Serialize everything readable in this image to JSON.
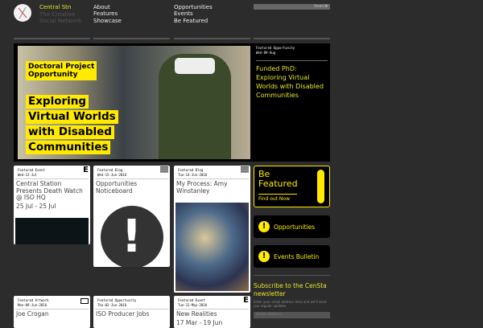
{
  "brand": {
    "name": "Central Stn",
    "tagline1": "The Creative",
    "tagline2": "Social Network"
  },
  "nav": {
    "col1": [
      "About",
      "Features",
      "Showcase"
    ],
    "col2": [
      "Opportunities",
      "Events",
      "Be Featured"
    ]
  },
  "search": {
    "placeholder": "Search"
  },
  "hero": {
    "image_line1": "Doctoral Project",
    "image_line2": "Opportunity",
    "image_title": [
      "Exploring",
      "Virtual Worlds",
      "with Disabled",
      "Communities"
    ],
    "category": "Featured Opportunity",
    "date": "Wed-09-Aug",
    "title": "Funded PhD: Exploring Virtual Worlds with Disabled Communities"
  },
  "cards": [
    {
      "category": "Featured Event",
      "date": "Wed-12-Jul",
      "icon": "E",
      "title": "Central Station Presents Death Watch @ ISO HQ",
      "dates": "25 Jul - 25 Jul"
    },
    {
      "category": "Featured Blog",
      "date": "Wed-15-Jun-2016",
      "title": "Opportunities Noticeboard"
    },
    {
      "category": "Featured Blog",
      "date": "Tue-14-Jun-2016",
      "title": "My Process: Amy Winstanley"
    },
    {
      "category": "Featured Artwork",
      "date": "Mon-09-Jun-2016",
      "title": "Joe Crogan"
    },
    {
      "category": "Featured Opportunity",
      "date": "Thu-02-Jun-2016",
      "title": "ISO Producer Jobs"
    },
    {
      "category": "Featured Event",
      "date": "Tue-31-May-2016",
      "icon": "E",
      "title": "New Realities",
      "dates": "17 Mar - 19 Jun"
    }
  ],
  "sidebar": {
    "be_featured": "Be Featured",
    "find_out": "Find out Now",
    "opportunities": "Opportunities",
    "events": "Events Bulletin",
    "subscribe_title": "Subscribe to the CenSta newsletter",
    "subscribe_text": "Enter your email address here and we'll send you regular updates",
    "email_placeholder": "Email address"
  },
  "colors": {
    "accent": "#ffea00",
    "background": "#2c2c2c"
  }
}
